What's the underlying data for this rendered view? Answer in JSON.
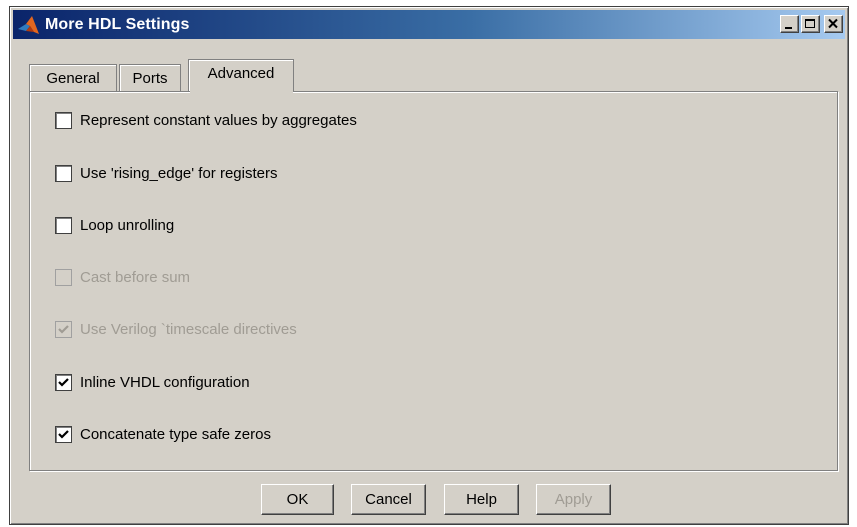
{
  "window": {
    "title": "More HDL Settings",
    "controls": {
      "minimize": "minimize-icon",
      "maximize": "maximize-icon",
      "close": "close-icon"
    }
  },
  "tabs": [
    {
      "label": "General",
      "selected": false
    },
    {
      "label": "Ports",
      "selected": false
    },
    {
      "label": "Advanced",
      "selected": true
    }
  ],
  "options": [
    {
      "label": "Represent constant values by aggregates",
      "checked": false,
      "enabled": true
    },
    {
      "label": "Use 'rising_edge' for registers",
      "checked": false,
      "enabled": true
    },
    {
      "label": "Loop unrolling",
      "checked": false,
      "enabled": true
    },
    {
      "label": "Cast before sum",
      "checked": false,
      "enabled": false
    },
    {
      "label": "Use Verilog `timescale directives",
      "checked": true,
      "enabled": false
    },
    {
      "label": "Inline VHDL configuration",
      "checked": true,
      "enabled": true
    },
    {
      "label": "Concatenate type safe zeros",
      "checked": true,
      "enabled": true
    }
  ],
  "buttons": {
    "ok": "OK",
    "cancel": "Cancel",
    "help": "Help",
    "apply": "Apply"
  },
  "colors": {
    "dialog_bg": "#d4d0c8",
    "titlebar_start": "#0a246a",
    "titlebar_end": "#a6caf0",
    "disabled_text": "#a09c94"
  }
}
